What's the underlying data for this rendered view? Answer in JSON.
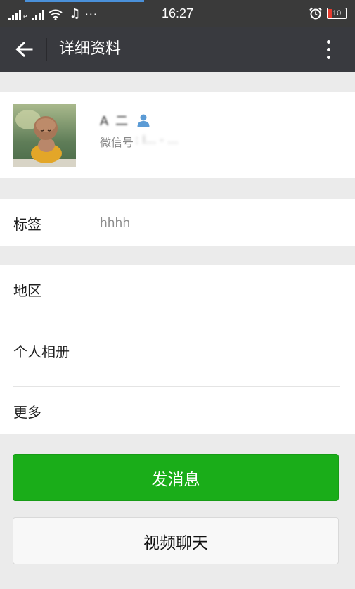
{
  "status_bar": {
    "time": "16:27",
    "battery_level": "10",
    "signal_label": "e"
  },
  "header": {
    "title": "详细资料"
  },
  "profile": {
    "nickname": "A 二",
    "wechat_id_label": "微信号",
    "wechat_id_value": ": l...  - ..."
  },
  "tags": {
    "label": "标签",
    "value": "hhhh"
  },
  "info_rows": [
    {
      "label": "地区",
      "value": ""
    },
    {
      "label": "个人相册"
    },
    {
      "label": "更多"
    }
  ],
  "actions": {
    "send_message": "发消息",
    "video_chat": "视频聊天"
  },
  "colors": {
    "primary_button": "#1aad19",
    "title_bar": "#393a3f",
    "status_bar": "#3a3a3a",
    "background": "#ebebeb",
    "contact_icon": "#5b9bd5"
  },
  "icons": [
    "back-arrow-icon",
    "more-vertical-icon",
    "contact-person-icon",
    "alarm-icon",
    "music-note-icon",
    "wifi-icon"
  ]
}
